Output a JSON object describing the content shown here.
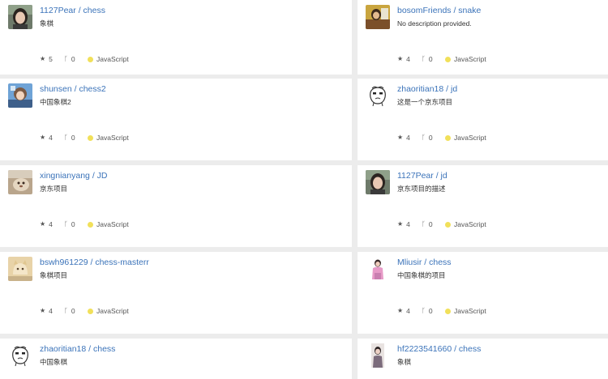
{
  "repos": [
    {
      "owner": "1127Pear",
      "name": "chess",
      "description": "象棋",
      "stars": "5",
      "forks": "0",
      "language": "JavaScript",
      "avatar": "girl-photo"
    },
    {
      "owner": "bosomFriends",
      "name": "snake",
      "description": "No description provided.",
      "stars": "4",
      "forks": "0",
      "language": "JavaScript",
      "avatar": "character-photo"
    },
    {
      "owner": "shunsen",
      "name": "chess2",
      "description": "中国象棋2",
      "stars": "4",
      "forks": "0",
      "language": "JavaScript",
      "avatar": "anime-photo"
    },
    {
      "owner": "zhaoritian18",
      "name": "jd",
      "description": "这是一个京东项目",
      "stars": "4",
      "forks": "0",
      "language": "JavaScript",
      "avatar": "cartoon-face"
    },
    {
      "owner": "xingnianyang",
      "name": "JD",
      "description": "京东项目",
      "stars": "4",
      "forks": "0",
      "language": "JavaScript",
      "avatar": "pet-photo"
    },
    {
      "owner": "1127Pear",
      "name": "jd",
      "description": "京东项目的描述",
      "stars": "4",
      "forks": "0",
      "language": "JavaScript",
      "avatar": "girl-photo"
    },
    {
      "owner": "bswh961229",
      "name": "chess-masterr",
      "description": "象棋项目",
      "stars": "4",
      "forks": "0",
      "language": "JavaScript",
      "avatar": "cat-photo"
    },
    {
      "owner": "Mliusir",
      "name": "chess",
      "description": "中国象棋的项目",
      "stars": "4",
      "forks": "0",
      "language": "JavaScript",
      "avatar": "figure-photo"
    },
    {
      "owner": "zhaoritian18",
      "name": "chess",
      "description": "中国象棋",
      "stars": "",
      "forks": "",
      "language": "",
      "avatar": "cartoon-face"
    },
    {
      "owner": "hf2223541660",
      "name": "chess",
      "description": "象棋",
      "stars": "",
      "forks": "",
      "language": "",
      "avatar": "person-photo"
    }
  ],
  "separator": "/",
  "colors": {
    "link": "#3b73b9",
    "javascript": "#f1e05a",
    "background": "#ececec",
    "card": "#ffffff"
  },
  "icons": {
    "star": "star-icon",
    "fork": "fork-icon"
  }
}
